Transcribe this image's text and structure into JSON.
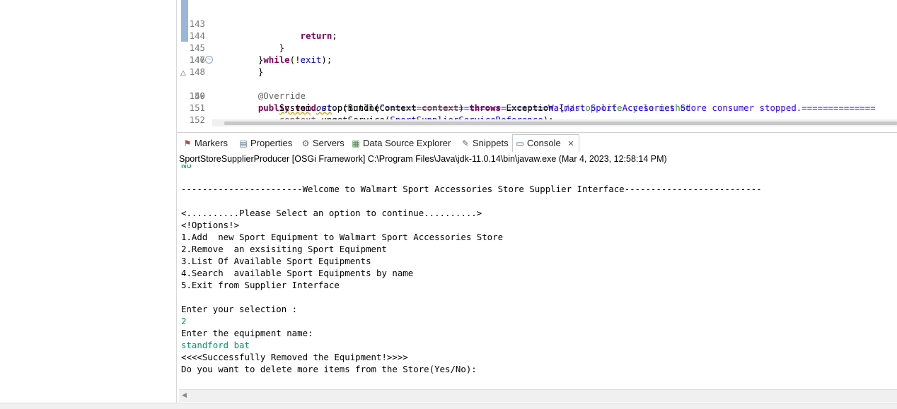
{
  "editor": {
    "lines": [
      {
        "num": "143",
        "code": "            return;"
      },
      {
        "num": "144",
        "code": "        }"
      },
      {
        "num": "145",
        "code": "    }while(!exit);"
      },
      {
        "num": "146",
        "code": "    }"
      },
      {
        "num": "147",
        "code": ""
      },
      {
        "num": "148",
        "code": "    @Override"
      },
      {
        "num": "149",
        "code": "    public void stop(BundleContext context) throws Exception {//stop life cycle method"
      },
      {
        "num": "150",
        "code": "        System.out.println(\"===============================Walmart Sport Accesories Store consumer stopped.=============="
      },
      {
        "num": "151",
        "code": "        context.ungetService(SportSupplierServiceReference);"
      },
      {
        "num": "152",
        "code": "    }"
      }
    ]
  },
  "tabs": [
    {
      "label": "Markers",
      "icon": "markers-icon"
    },
    {
      "label": "Properties",
      "icon": "properties-icon"
    },
    {
      "label": "Servers",
      "icon": "servers-icon"
    },
    {
      "label": "Data Source Explorer",
      "icon": "data-source-explorer-icon"
    },
    {
      "label": "Snippets",
      "icon": "snippets-icon"
    },
    {
      "label": "Console",
      "icon": "console-icon",
      "close": "✕"
    }
  ],
  "console": {
    "header": "SportStoreSupplierProducer [OSGi Framework] C:\\Program Files\\Java\\jdk-11.0.14\\bin\\javaw.exe  (Mar 4, 2023, 12:58:14 PM)",
    "clipped_line": "No",
    "lines": [
      {
        "text": "",
        "input": false
      },
      {
        "text": "-----------------------Welcome to Walmart Sport Accessories Store Supplier Interface--------------------------",
        "input": false
      },
      {
        "text": "",
        "input": false
      },
      {
        "text": "<..........Please Select an option to continue..........>",
        "input": false
      },
      {
        "text": "<!Options!>",
        "input": false
      },
      {
        "text": "1.Add  new Sport Equipment to Walmart Sport Accessories Store",
        "input": false
      },
      {
        "text": "2.Remove  an exsisiting Sport Equipment",
        "input": false
      },
      {
        "text": "3.List Of Available Sport Equipments",
        "input": false
      },
      {
        "text": "4.Search  available Sport Equipments by name",
        "input": false
      },
      {
        "text": "5.Exit from Supplier Interface",
        "input": false
      },
      {
        "text": "",
        "input": false
      },
      {
        "text": "Enter your selection :",
        "input": false
      },
      {
        "text": "2",
        "input": true
      },
      {
        "text": "Enter the equipment name:",
        "input": false
      },
      {
        "text": "standford bat",
        "input": true
      },
      {
        "text": "<<<<Successfully Removed the Equipment!>>>>",
        "input": false
      },
      {
        "text": "Do you want to delete more items from the Store(Yes/No):",
        "input": false
      }
    ]
  }
}
